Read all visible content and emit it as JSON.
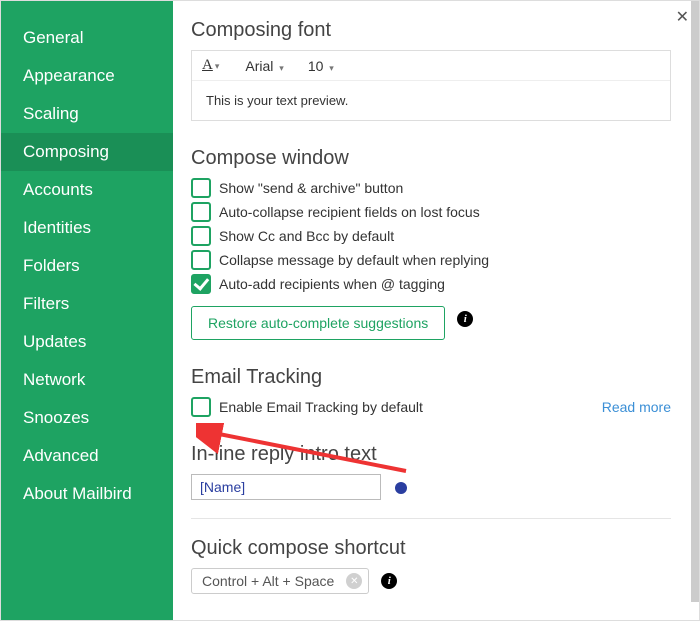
{
  "close_label": "✕",
  "sidebar": {
    "items": [
      {
        "label": "General"
      },
      {
        "label": "Appearance"
      },
      {
        "label": "Scaling"
      },
      {
        "label": "Composing",
        "selected": true
      },
      {
        "label": "Accounts"
      },
      {
        "label": "Identities"
      },
      {
        "label": "Folders"
      },
      {
        "label": "Filters"
      },
      {
        "label": "Updates"
      },
      {
        "label": "Network"
      },
      {
        "label": "Snoozes"
      },
      {
        "label": "Advanced"
      },
      {
        "label": "About Mailbird"
      }
    ]
  },
  "composing_font": {
    "title": "Composing font",
    "font_name": "Arial",
    "font_size": "10",
    "preview_text": "This is your text preview."
  },
  "compose_window": {
    "title": "Compose window",
    "options": [
      {
        "label": "Show \"send & archive\" button",
        "checked": false
      },
      {
        "label": "Auto-collapse recipient fields on lost focus",
        "checked": false
      },
      {
        "label": "Show Cc and Bcc by default",
        "checked": false
      },
      {
        "label": "Collapse message by default when replying",
        "checked": false
      },
      {
        "label": "Auto-add recipients when @ tagging",
        "checked": true
      }
    ],
    "restore_button": "Restore auto-complete suggestions"
  },
  "email_tracking": {
    "title": "Email Tracking",
    "option_label": "Enable Email Tracking by default",
    "option_checked": false,
    "read_more": "Read more"
  },
  "inline_reply": {
    "title": "In-line reply intro text",
    "value": "[Name]"
  },
  "quick_shortcut": {
    "title": "Quick compose shortcut",
    "value": "Control + Alt + Space"
  }
}
